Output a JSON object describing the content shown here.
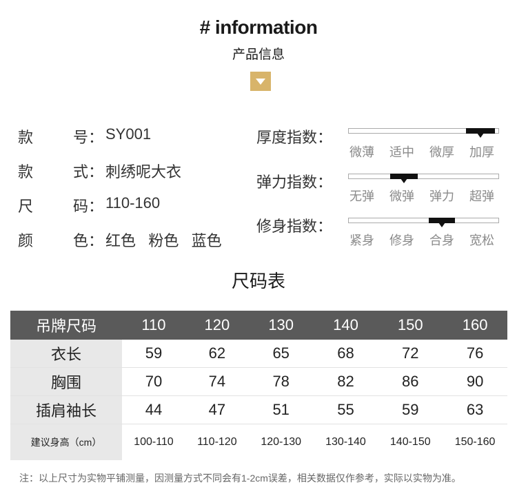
{
  "header": {
    "title_en": "# information",
    "title_cn": "产品信息"
  },
  "info": [
    {
      "label": "款        号：",
      "value": "SY001"
    },
    {
      "label": "款        式：",
      "value": "刺绣呢大衣"
    },
    {
      "label": "尺        码：",
      "value": "110-160"
    },
    {
      "label": "颜        色：",
      "value": "红色   粉色   蓝色"
    }
  ],
  "info_labels": {
    "l1a": "款",
    "l1b": "号：",
    "l2a": "款",
    "l2b": "式：",
    "l3a": "尺",
    "l3b": "码：",
    "l4a": "颜",
    "l4b": "色："
  },
  "meters": [
    {
      "label": "厚度指数：",
      "options": [
        "微薄",
        "适中",
        "微厚",
        "加厚"
      ],
      "selected": "加厚",
      "level": 0.88
    },
    {
      "label": "弹力指数：",
      "options": [
        "无弹",
        "微弹",
        "弹力",
        "超弹"
      ],
      "selected": "微弹",
      "level": 0.37
    },
    {
      "label": "修身指数：",
      "options": [
        "紧身",
        "修身",
        "合身",
        "宽松"
      ],
      "selected": "合身",
      "level": 0.62
    }
  ],
  "size_table": {
    "title": "尺码表",
    "header": [
      "吊牌尺码",
      "110",
      "120",
      "130",
      "140",
      "150",
      "160"
    ],
    "rows": [
      [
        "衣长",
        "59",
        "62",
        "65",
        "68",
        "72",
        "76"
      ],
      [
        "胸围",
        "70",
        "74",
        "78",
        "82",
        "86",
        "90"
      ],
      [
        "插肩袖长",
        "44",
        "47",
        "51",
        "55",
        "59",
        "63"
      ],
      [
        "建议身高（cm）",
        "100-110",
        "110-120",
        "120-130",
        "130-140",
        "140-150",
        "150-160"
      ]
    ]
  },
  "note": "注：以上尺寸为实物平铺测量，因测量方式不同会有1-2cm误差，相关数据仅作参考，实际以实物为准。",
  "colors": {
    "badge": "#d8b46a",
    "table_header": "#5a5a5a",
    "row_label_bg": "#e8e8e8",
    "marker": "#111111"
  }
}
